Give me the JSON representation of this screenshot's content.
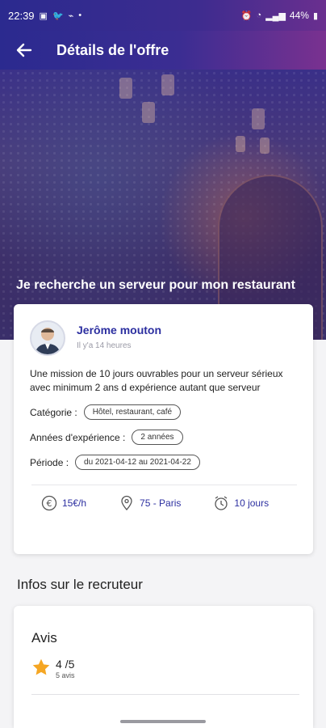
{
  "status_bar": {
    "time": "22:39",
    "battery": "44%"
  },
  "header": {
    "title": "Détails de l'offre"
  },
  "hero": {
    "title": "Je recherche un serveur pour mon restaurant"
  },
  "offer": {
    "recruiter_name": "Jerôme mouton",
    "posted": "Il y'a 14 heures",
    "description": "Une mission de 10 jours ouvrables pour un serveur sérieux avec minimum 2 ans d expérience autant que serveur",
    "category_label": "Catégorie :",
    "category_value": "Hôtel, restaurant, café",
    "experience_label": "Années d'expérience :",
    "experience_value": "2 années",
    "period_label": "Période :",
    "period_value": "du 2021-04-12 au 2021-04-22",
    "salary": "15€/h",
    "location": "75 - Paris",
    "duration": "10 jours"
  },
  "recruiter_section": {
    "title": "Infos sur le recruteur",
    "reviews_heading": "Avis",
    "rating": "4 /5",
    "review_count": "5 avis"
  },
  "colors": {
    "primary": "#2c2fa0",
    "star": "#f5a623",
    "header_start": "#2b2a8f",
    "header_end": "#7a3190"
  }
}
